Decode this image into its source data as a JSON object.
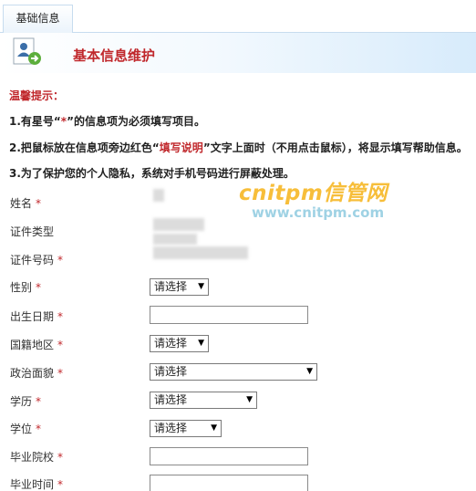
{
  "tab": {
    "label": "基础信息"
  },
  "header": {
    "title": "基本信息维护"
  },
  "tips": {
    "title": "温馨提示：",
    "line1_pre": "1.有星号“",
    "line1_star": "*",
    "line1_post": "”的信息项为必须填写项目。",
    "line2_pre": "2.把鼠标放在信息项旁边红色“",
    "line2_red": "填写说明",
    "line2_post": "”文字上面时（不用点击鼠标），将显示填写帮助信息。",
    "line3": "3.为了保护您的个人隐私，系统对手机号码进行屏蔽处理。"
  },
  "watermark": {
    "main": "cnitpm信管网",
    "sub": "www.cnitpm.com"
  },
  "form": {
    "required_mark": "*",
    "name": {
      "label": "姓名"
    },
    "id_type": {
      "label": "证件类型"
    },
    "id_number": {
      "label": "证件号码"
    },
    "gender": {
      "label": "性别",
      "value": "请选择"
    },
    "birth_date": {
      "label": "出生日期",
      "value": ""
    },
    "nationality": {
      "label": "国籍地区",
      "value": "请选择"
    },
    "political_status": {
      "label": "政治面貌",
      "value": "请选择"
    },
    "education": {
      "label": "学历",
      "value": "请选择"
    },
    "degree": {
      "label": "学位",
      "value": "请选择"
    },
    "school": {
      "label": "毕业院校",
      "value": ""
    },
    "graduation_time": {
      "label": "毕业时间",
      "value": ""
    }
  }
}
